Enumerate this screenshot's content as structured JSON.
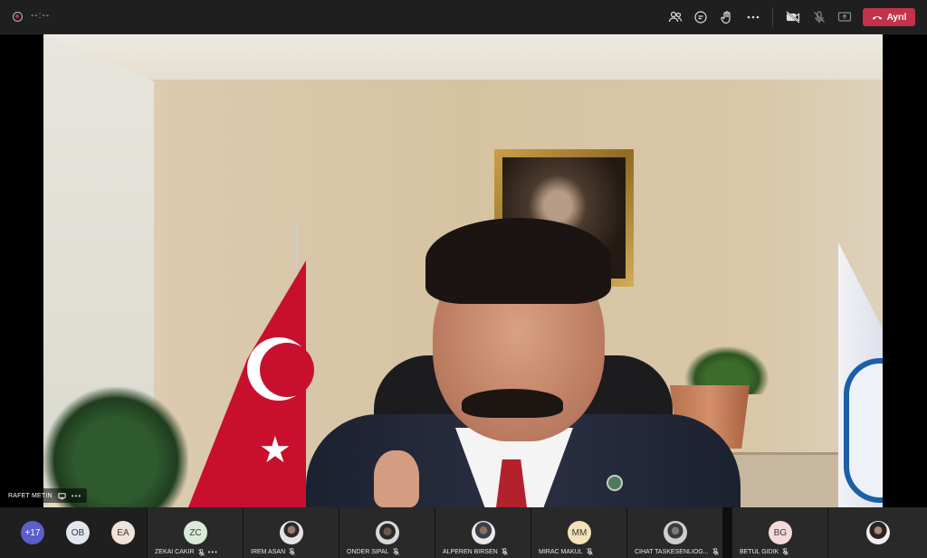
{
  "topbar": {
    "timer": "--:--",
    "icons": [
      "participants-icon",
      "chat-icon",
      "raise-hand-icon",
      "more-options-icon",
      "camera-off-icon",
      "mic-off-icon",
      "share-screen-icon"
    ],
    "leave_label": "Ayrıl",
    "leave_color": "#c4314b"
  },
  "presenter": {
    "name": "RAFET METIN"
  },
  "participants": {
    "overflow_count": "+17",
    "overflow_avatars": [
      {
        "initials": "OB",
        "color": "#e2e6ef"
      },
      {
        "initials": "EA",
        "color": "#f1e3d8"
      }
    ],
    "tiles": [
      {
        "name": "ZEKAI CAKIR",
        "initials": "ZC",
        "color": "#d8ebd6",
        "has_more": true
      },
      {
        "name": "IREM ASAN",
        "initials": "",
        "color": "",
        "has_more": false
      },
      {
        "name": "ONDER SIPAL",
        "initials": "",
        "color": "",
        "has_more": false
      },
      {
        "name": "ALPEREN BIRSEN",
        "initials": "",
        "color": "",
        "has_more": false
      },
      {
        "name": "MIRAC MAKUL",
        "initials": "MM",
        "color": "#f4e2b8",
        "has_more": false
      },
      {
        "name": "CIHAT TASKESENLIOG...",
        "initials": "",
        "color": "",
        "has_more": false
      },
      {
        "name": "BETUL GIDIK",
        "initials": "BG",
        "color": "#f5dada",
        "has_more": false
      },
      {
        "name": "",
        "initials": "",
        "color": "",
        "has_more": false
      }
    ],
    "overflow_color": "#5b5fc7"
  }
}
